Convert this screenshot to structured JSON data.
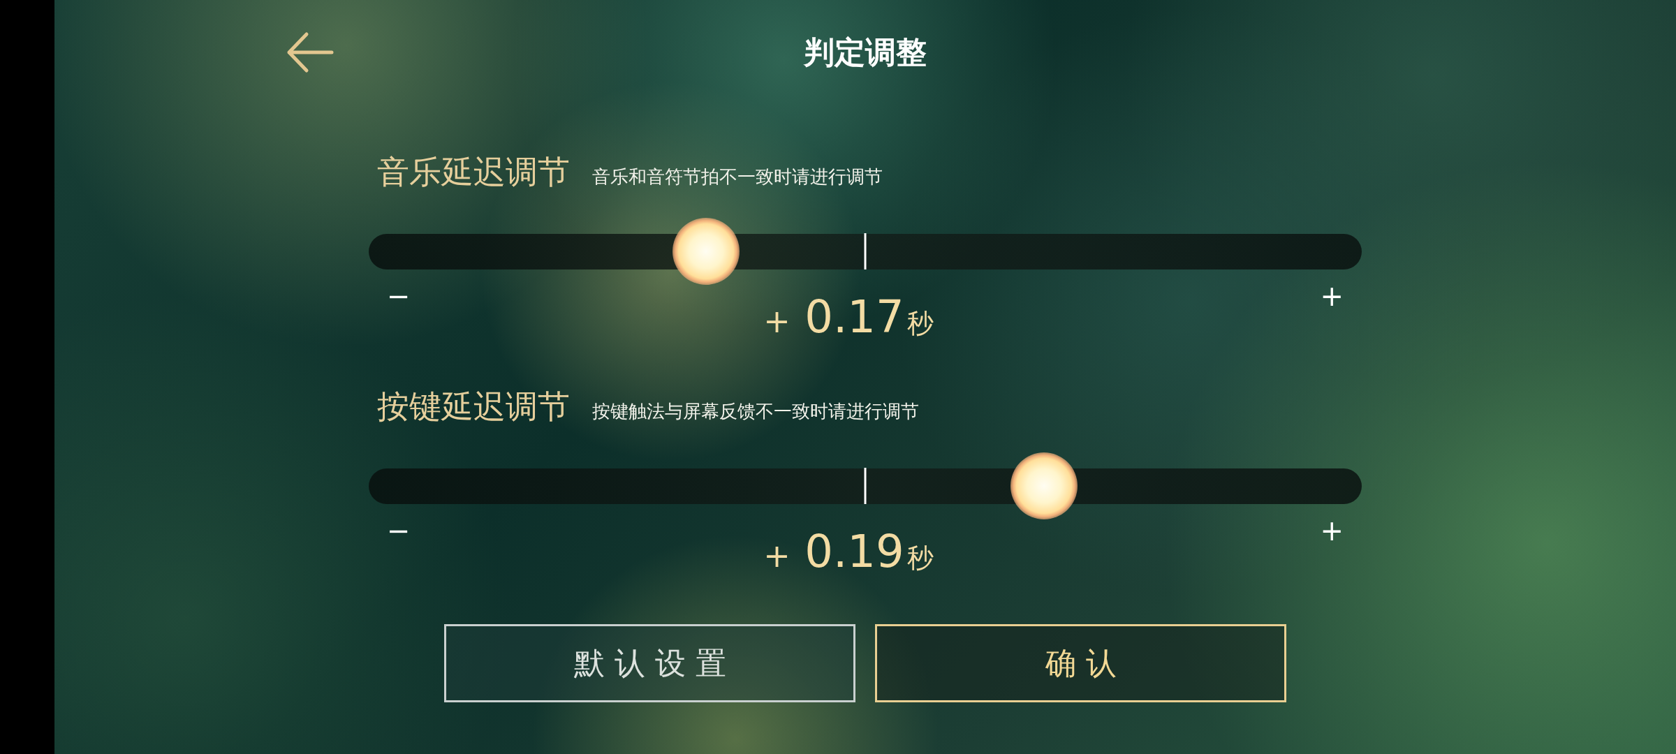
{
  "header": {
    "title": "判定调整"
  },
  "sliders": [
    {
      "label": "音乐延迟调节",
      "hint": "音乐和音符节拍不一致时请进行调节",
      "level": 0.34,
      "minus": "−",
      "plus": "+",
      "reading": "+ 0.17",
      "unit": "秒"
    },
    {
      "label": "按键延迟调节",
      "hint": "按键触法与屏幕反馈不一致时请进行调节",
      "level": 0.68,
      "minus": "−",
      "plus": "+",
      "reading": "+ 0.19",
      "unit": "秒"
    }
  ],
  "buttons": [
    {
      "label": "默认设置",
      "kind": "secondary"
    },
    {
      "label": "确认",
      "kind": "primary"
    }
  ]
}
